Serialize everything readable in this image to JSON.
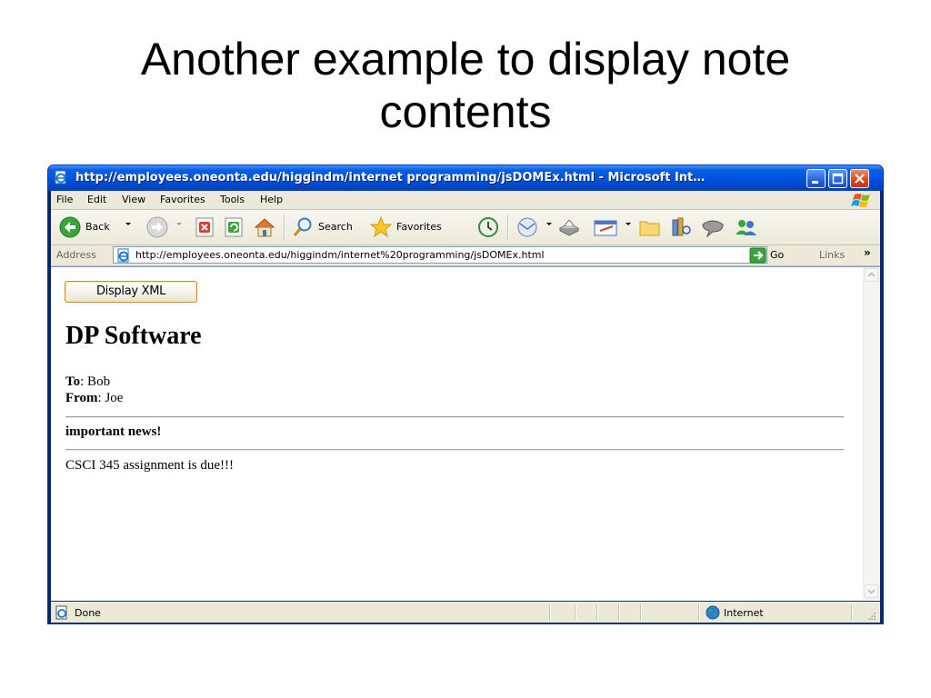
{
  "slide": {
    "title_line1": "Another example to display note",
    "title_line2": "contents"
  },
  "window": {
    "title": "http://employees.oneonta.edu/higgindm/internet programming/jsDOMEx.html - Microsoft Int…",
    "controls": [
      "minimize-icon",
      "maximize-icon",
      "close-icon"
    ]
  },
  "menubar": {
    "items": [
      {
        "label": "File",
        "accel": "F"
      },
      {
        "label": "Edit",
        "accel": "E"
      },
      {
        "label": "View",
        "accel": "V"
      },
      {
        "label": "Favorites",
        "accel": "a"
      },
      {
        "label": "Tools",
        "accel": "T"
      },
      {
        "label": "Help",
        "accel": "H"
      }
    ]
  },
  "toolbar": {
    "back_label": "Back",
    "search_label": "Search",
    "favorites_label": "Favorites"
  },
  "addressbar": {
    "label": "Address",
    "url": "http://employees.oneonta.edu/higgindm/internet%20programming/jsDOMEx.html",
    "go_label": "Go",
    "links_label": "Links",
    "links_chevron": "»"
  },
  "page": {
    "button_label": "Display XML",
    "heading": "DP Software",
    "to_label": "To",
    "to_value": ": Bob",
    "from_label": "From",
    "from_value": ": Joe",
    "subject": "important news!",
    "body": "CSCI 345 assignment is due!!!"
  },
  "statusbar": {
    "status": "Done",
    "zone": "Internet"
  },
  "colors": {
    "titlebar": "#0054e3",
    "chrome": "#ece9d8",
    "button_border": "#c88d2e"
  }
}
